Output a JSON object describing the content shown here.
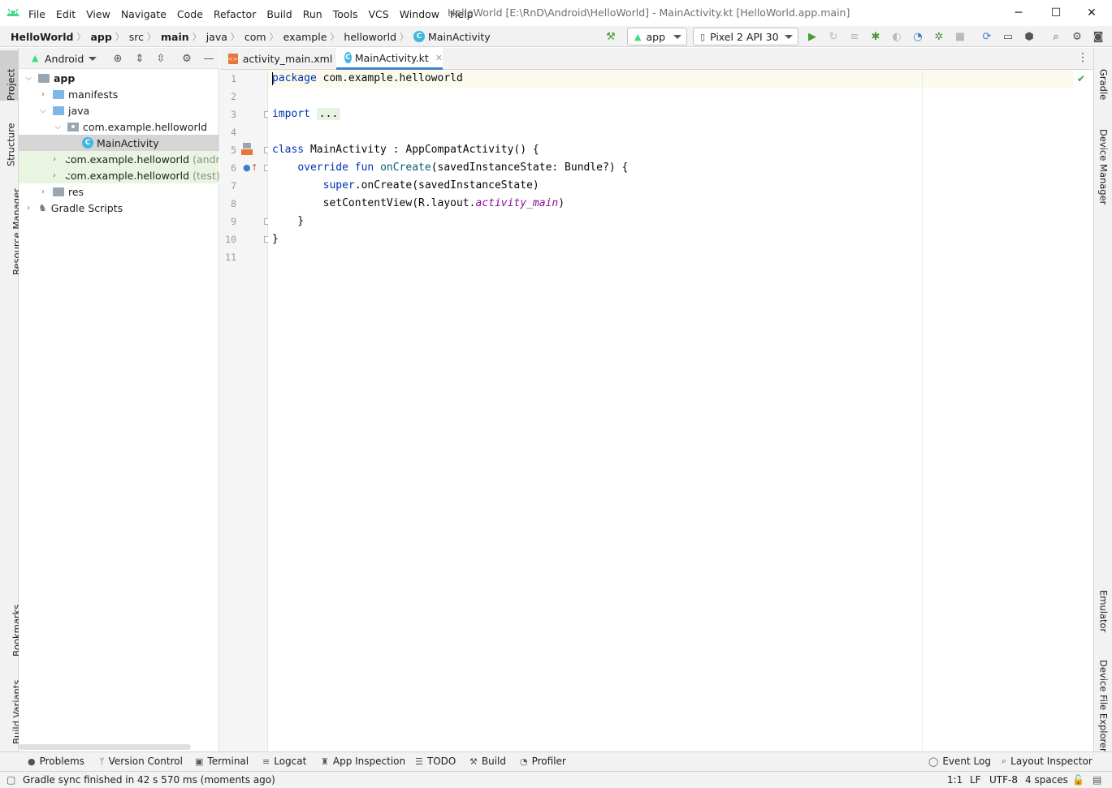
{
  "window": {
    "title": "HelloWorld [E:\\RnD\\Android\\HelloWorld] - MainActivity.kt [HelloWorld.app.main]",
    "minimize": "─",
    "maximize": "☐",
    "close": "✕"
  },
  "menu": [
    "File",
    "Edit",
    "View",
    "Navigate",
    "Code",
    "Refactor",
    "Build",
    "Run",
    "Tools",
    "VCS",
    "Window",
    "Help"
  ],
  "breadcrumbs": [
    "HelloWorld",
    "app",
    "src",
    "main",
    "java",
    "com",
    "example",
    "helloworld",
    "MainActivity"
  ],
  "toolbar": {
    "run_config": "app",
    "device": "Pixel 2 API 30"
  },
  "left_stripe": [
    "Project",
    "Structure",
    "Resource Manager",
    "Bookmarks",
    "Build Variants"
  ],
  "right_stripe": [
    "Gradle",
    "Device Manager",
    "Emulator",
    "Device File Explorer"
  ],
  "project": {
    "view_mode": "Android",
    "tree": [
      {
        "label": "app",
        "suffix": ""
      },
      {
        "label": "manifests",
        "suffix": ""
      },
      {
        "label": "java",
        "suffix": ""
      },
      {
        "label": "com.example.helloworld",
        "suffix": ""
      },
      {
        "label": "MainActivity",
        "suffix": ""
      },
      {
        "label": "com.example.helloworld",
        "suffix": "(andro"
      },
      {
        "label": "com.example.helloworld",
        "suffix": "(test)"
      },
      {
        "label": "res",
        "suffix": ""
      },
      {
        "label": "Gradle Scripts",
        "suffix": ""
      }
    ]
  },
  "editor": {
    "tabs": [
      {
        "label": "activity_main.xml"
      },
      {
        "label": "MainActivity.kt"
      }
    ],
    "line_numbers": [
      "1",
      "2",
      "3",
      "4",
      "5",
      "6",
      "7",
      "8",
      "9",
      "10",
      "11"
    ],
    "code": {
      "l1_kw": "package",
      "l1_rest": " com.example.helloworld",
      "l3_kw": "import",
      "l3_fold": "...",
      "l6_kw": "class",
      "l6_rest": " MainActivity : AppCompatActivity() {",
      "l7_indent": "    ",
      "l7_kw": "override fun",
      "l7_fn": "onCreate",
      "l7_rest": "(savedInstanceState: Bundle?) {",
      "l8_indent": "        ",
      "l8_kw": "super",
      "l8_rest": ".onCreate(savedInstanceState)",
      "l9_indent": "        ",
      "l9_rest": "setContentView(R.layout.",
      "l9_it": "activity_main",
      "l9_end": ")",
      "l10": "    }",
      "l11": "}"
    }
  },
  "bottom_tabs": [
    "Problems",
    "Version Control",
    "Terminal",
    "Logcat",
    "App Inspection",
    "TODO",
    "Build",
    "Profiler"
  ],
  "bottom_right_tabs": [
    "Event Log",
    "Layout Inspector"
  ],
  "status": {
    "message": "Gradle sync finished in 42 s 570 ms (moments ago)",
    "position": "1:1",
    "line_sep": "LF",
    "encoding": "UTF-8",
    "indent": "4 spaces"
  },
  "colors": {
    "keyword": "#0033b3",
    "function": "#00627a",
    "italic_field": "#871094",
    "android_green": "#3ddc84",
    "accent": "#4083c9"
  }
}
